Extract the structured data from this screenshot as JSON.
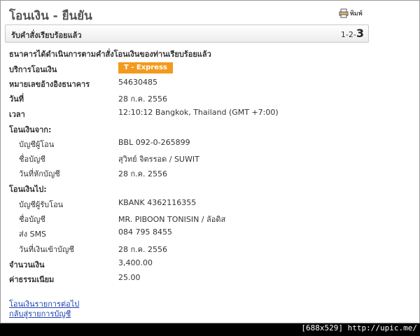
{
  "page": {
    "title": "โอนเงิน - ยืนยัน",
    "print_label": "พิมพ์",
    "step_label": "รับคำสั่งเรียบร้อยแล้ว",
    "step_prefix": "1-2-",
    "step_current": "3",
    "confirm_message": "ธนาคารได้ดำเนินการตามคำสั่งโอนเงินของท่านเรียบร้อยแล้ว"
  },
  "details": {
    "service_label": "บริการโอนเงิน",
    "service_value": "T - Express",
    "ref_label": "หมายเลขอ้างอิงธนาคาร",
    "ref_value": "54630485",
    "date_label": "วันที่",
    "date_value": "28 ก.ค. 2556",
    "time_label": "เวลา",
    "time_value": "12:10:12 Bangkok, Thailand (GMT +7:00)",
    "from_header": "โอนเงินจาก:",
    "from_account_label": "บัญชีผู้โอน",
    "from_account_value": "BBL 092-0-265899",
    "from_name_label": "ชื่อบัญชี",
    "from_name_value": "สุวิทย์ จิตรรอด / SUWIT",
    "debit_date_label": "วันที่หักบัญชี",
    "debit_date_value": "28 ก.ค. 2556",
    "to_header": "โอนเงินไป:",
    "to_account_label": "บัญชีผู้รับโอน",
    "to_account_value": "KBANK 4362116355",
    "to_name_label": "ชื่อบัญชี",
    "to_name_value": "MR. PIBOON TONISIN / ลัอดิส",
    "sms_label": "ส่ง SMS",
    "sms_value": "084 795 8455",
    "credit_date_label": "วันที่เงินเข้าบัญชี",
    "credit_date_value": "28 ก.ค. 2556",
    "amount_label": "จำนวนเงิน",
    "amount_value": "3,400.00",
    "fee_label": "ค่าธรรมเนียม",
    "fee_value": "25.00"
  },
  "links": {
    "next_transfer": "โอนเงินรายการต่อไป",
    "back_to_accounts": "กลับสู่รายการบัญชี"
  },
  "watermark": "[688x529] http://upic.me/",
  "colors": {
    "badge": "#f39a1e",
    "link": "#1a3fb0"
  },
  "icons": {
    "print": "printer-icon"
  }
}
